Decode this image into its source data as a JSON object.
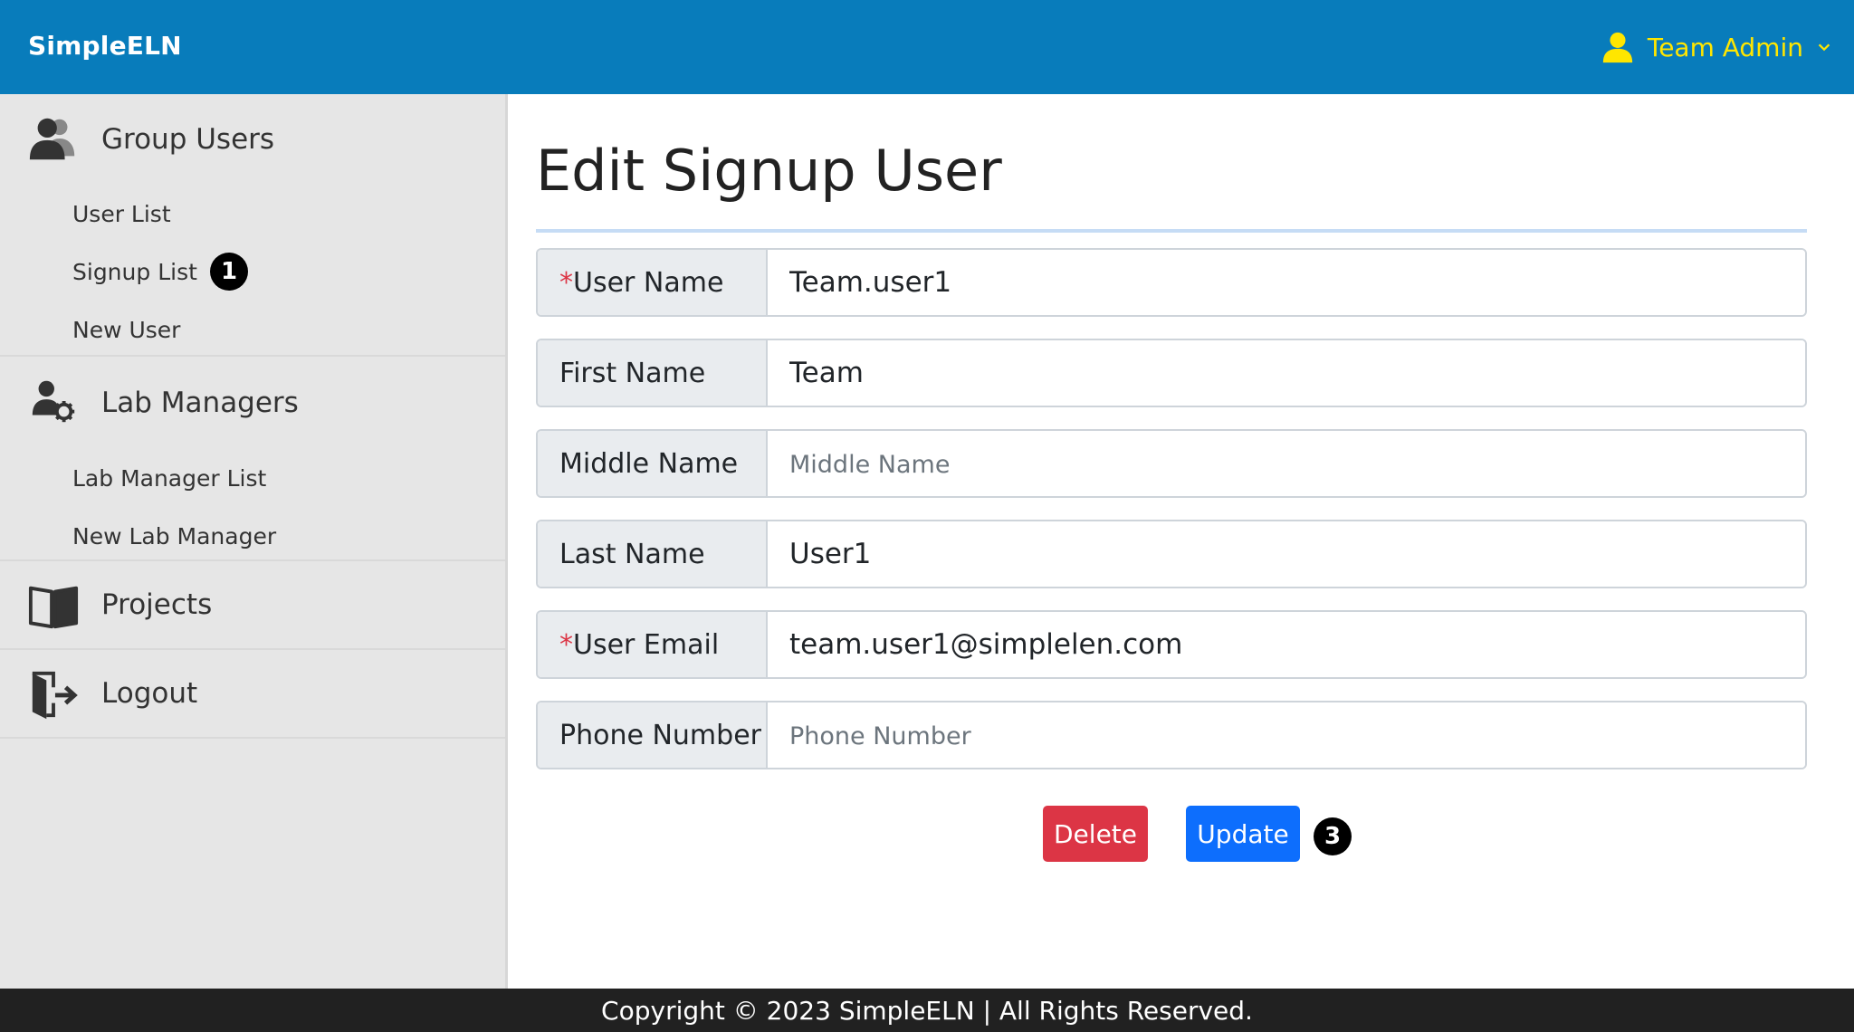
{
  "header": {
    "brand": "SimpleELN",
    "user_name": "Team Admin",
    "brand_color": "#087cbb",
    "user_color": "#ffe600"
  },
  "sidebar": {
    "sections": [
      {
        "title": "Group Users",
        "icon": "group-users-icon",
        "items": [
          {
            "label": "User List"
          },
          {
            "label": "Signup List",
            "badge": "1"
          },
          {
            "label": "New User"
          }
        ]
      },
      {
        "title": "Lab Managers",
        "icon": "user-gear-icon",
        "items": [
          {
            "label": "Lab Manager List"
          },
          {
            "label": "New Lab Manager"
          }
        ]
      },
      {
        "title": "Projects",
        "icon": "book-icon"
      },
      {
        "title": "Logout",
        "icon": "logout-icon"
      }
    ]
  },
  "main": {
    "title": "Edit Signup User",
    "fields": [
      {
        "label": "User Name",
        "required": "*",
        "value": "Team.user1",
        "placeholder": ""
      },
      {
        "label": "First Name",
        "value": "Team",
        "placeholder": ""
      },
      {
        "label": "Middle Name",
        "value": "",
        "placeholder": "Middle Name"
      },
      {
        "label": "Last Name",
        "value": "User1",
        "placeholder": ""
      },
      {
        "label": "User Email",
        "required": "*",
        "value": "team.user1@simplelen.com",
        "placeholder": ""
      },
      {
        "label": "Phone Number",
        "value": "",
        "placeholder": "Phone Number"
      }
    ],
    "buttons": {
      "delete": "Delete",
      "update": "Update",
      "update_badge": "3",
      "delete_color": "#dc3545",
      "update_color": "#0d6efd"
    }
  },
  "footer": {
    "text": "Copyright © 2023 SimpleELN | All Rights Reserved."
  }
}
